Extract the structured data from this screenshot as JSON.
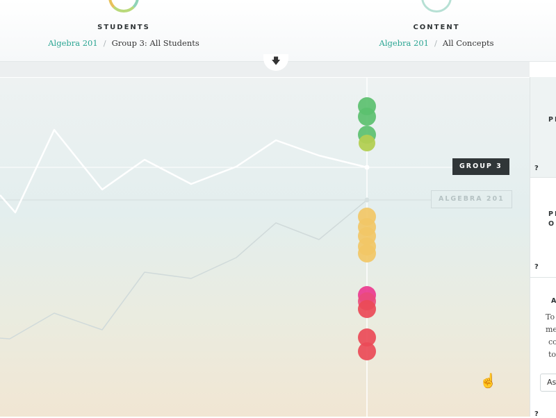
{
  "header": {
    "students": {
      "icon": "student-icon",
      "title": "STUDENTS",
      "breadcrumb": {
        "link": "Algebra 201",
        "separator": "/",
        "current": "Group 3: All Students"
      }
    },
    "content": {
      "icon": "compass-icon",
      "title": "CONTENT",
      "breadcrumb": {
        "link": "Algebra 201",
        "separator": "/",
        "current": "All Concepts"
      }
    },
    "toggle_icon": "arrow-down-icon"
  },
  "chart": {
    "labels": {
      "group": "GROUP 3",
      "baseline": "ALGEBRA 201"
    },
    "colors": {
      "green": "#5bc06f",
      "lime": "#b3cf52",
      "yellow": "#f2c766",
      "pink": "#ea3a8f",
      "red": "#ea4a57"
    }
  },
  "panel": {
    "card1": {
      "label": "PI",
      "help": "?"
    },
    "card2": {
      "label_line1": "PI",
      "label_line2": "OI",
      "help": "?"
    },
    "card3": {
      "title": "A",
      "lines": [
        "To",
        "me",
        "co",
        "to"
      ],
      "button": "As",
      "help": "?"
    }
  }
}
